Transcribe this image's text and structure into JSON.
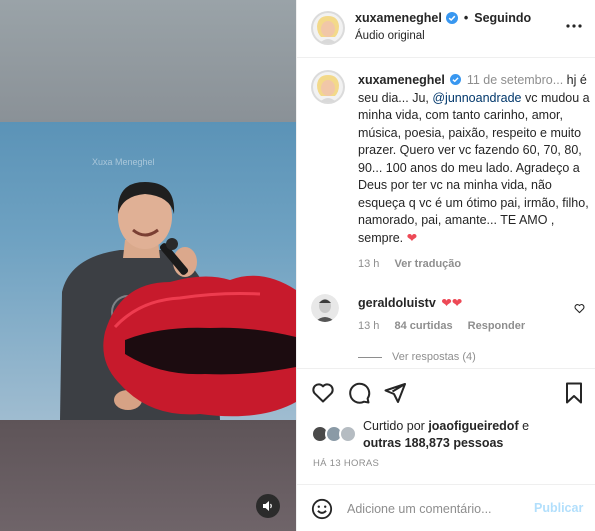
{
  "post": {
    "username": "xuxameneghel",
    "follow_label": "Seguindo",
    "audio_label": "Áudio original",
    "video_watermark": "Xuxa Meneghel"
  },
  "caption": {
    "username": "xuxameneghel",
    "date": "11 de setembro...",
    "text_before_mention": "hj é seu dia... Ju, ",
    "mention": "@junnoandrade",
    "text_after_mention": " vc mudou a minha vida, com tanto carinho, amor, música, poesia, paixão, respeito e muito prazer. Quero ver vc fazendo 60, 70, 80, 90... 100 anos do meu lado. Agradeço a Deus por ter vc na minha vida, não esqueça q vc é um ótimo pai, irmão, filho, namorado, pai, amante... TE AMO , sempre. ",
    "heart": "❤",
    "time": "13 h",
    "translate_label": "Ver tradução"
  },
  "comment": {
    "username": "geraldoluistv",
    "text": "❤❤",
    "time": "13 h",
    "likes": "84 curtidas",
    "reply_label": "Responder",
    "view_replies": "Ver respostas (4)"
  },
  "likes": {
    "prefix": "Curtido por",
    "user": "joaofigueiredof",
    "connector": "e",
    "others": "outras 188,873 pessoas"
  },
  "time_ago": "HÁ 13 HORAS",
  "add_comment": {
    "placeholder": "Adicione um comentário...",
    "publish_label": "Publicar"
  },
  "colors": {
    "verified": "#3897f0",
    "heart": "#ed4956",
    "publish_disabled": "#b2dffc",
    "mention": "#00376b"
  },
  "icons": [
    "verified-badge-icon",
    "more-options-icon",
    "heart-icon",
    "comment-icon",
    "share-icon",
    "bookmark-icon",
    "emoji-icon",
    "speaker-icon",
    "small-heart-icon"
  ]
}
